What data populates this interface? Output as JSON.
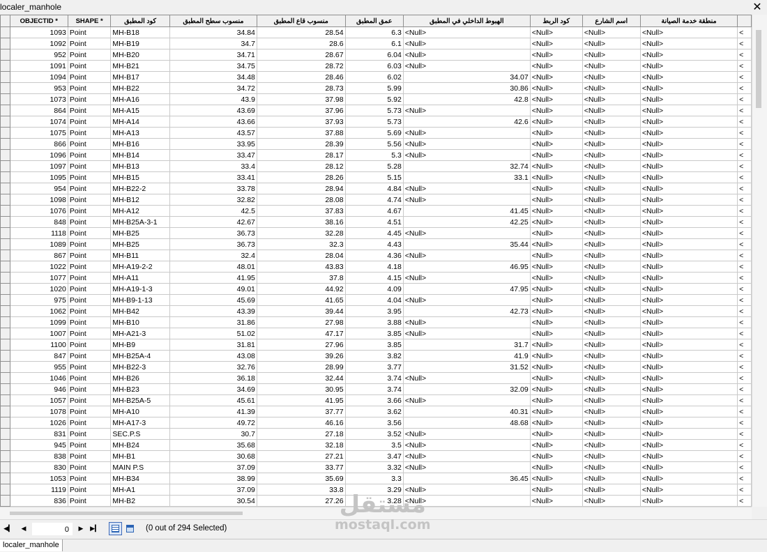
{
  "window": {
    "title": "localer_manhole",
    "close_glyph": "✕"
  },
  "table": {
    "columns": [
      "",
      "OBJECTID *",
      "SHAPE *",
      "كود المطبق",
      "منسوب سطح المطبق",
      "منسوب قاع المطبق",
      "عمق المطبق",
      "الهبوط الداخلي في المطبق",
      "كود الربط",
      "اسم الشارع",
      "منطقة خدمة الصيانة",
      ""
    ],
    "rows": [
      [
        "",
        "1093",
        "Point",
        "MH-B18",
        "34.84",
        "28.54",
        "6.3",
        "<Null>",
        "<Null>",
        "<Null>",
        "<Null>",
        "<"
      ],
      [
        "",
        "1092",
        "Point",
        "MH-B19",
        "34.7",
        "28.6",
        "6.1",
        "<Null>",
        "<Null>",
        "<Null>",
        "<Null>",
        "<"
      ],
      [
        "",
        "952",
        "Point",
        "MH-B20",
        "34.71",
        "28.67",
        "6.04",
        "<Null>",
        "<Null>",
        "<Null>",
        "<Null>",
        "<"
      ],
      [
        "",
        "1091",
        "Point",
        "MH-B21",
        "34.75",
        "28.72",
        "6.03",
        "<Null>",
        "<Null>",
        "<Null>",
        "<Null>",
        "<"
      ],
      [
        "",
        "1094",
        "Point",
        "MH-B17",
        "34.48",
        "28.46",
        "6.02",
        "34.07",
        "<Null>",
        "<Null>",
        "<Null>",
        "<"
      ],
      [
        "",
        "953",
        "Point",
        "MH-B22",
        "34.72",
        "28.73",
        "5.99",
        "30.86",
        "<Null>",
        "<Null>",
        "<Null>",
        "<"
      ],
      [
        "",
        "1073",
        "Point",
        "MH-A16",
        "43.9",
        "37.98",
        "5.92",
        "42.8",
        "<Null>",
        "<Null>",
        "<Null>",
        "<"
      ],
      [
        "",
        "864",
        "Point",
        "MH-A15",
        "43.69",
        "37.96",
        "5.73",
        "<Null>",
        "<Null>",
        "<Null>",
        "<Null>",
        "<"
      ],
      [
        "",
        "1074",
        "Point",
        "MH-A14",
        "43.66",
        "37.93",
        "5.73",
        "42.6",
        "<Null>",
        "<Null>",
        "<Null>",
        "<"
      ],
      [
        "",
        "1075",
        "Point",
        "MH-A13",
        "43.57",
        "37.88",
        "5.69",
        "<Null>",
        "<Null>",
        "<Null>",
        "<Null>",
        "<"
      ],
      [
        "",
        "866",
        "Point",
        "MH-B16",
        "33.95",
        "28.39",
        "5.56",
        "<Null>",
        "<Null>",
        "<Null>",
        "<Null>",
        "<"
      ],
      [
        "",
        "1096",
        "Point",
        "MH-B14",
        "33.47",
        "28.17",
        "5.3",
        "<Null>",
        "<Null>",
        "<Null>",
        "<Null>",
        "<"
      ],
      [
        "",
        "1097",
        "Point",
        "MH-B13",
        "33.4",
        "28.12",
        "5.28",
        "32.74",
        "<Null>",
        "<Null>",
        "<Null>",
        "<"
      ],
      [
        "",
        "1095",
        "Point",
        "MH-B15",
        "33.41",
        "28.26",
        "5.15",
        "33.1",
        "<Null>",
        "<Null>",
        "<Null>",
        "<"
      ],
      [
        "",
        "954",
        "Point",
        "MH-B22-2",
        "33.78",
        "28.94",
        "4.84",
        "<Null>",
        "<Null>",
        "<Null>",
        "<Null>",
        "<"
      ],
      [
        "",
        "1098",
        "Point",
        "MH-B12",
        "32.82",
        "28.08",
        "4.74",
        "<Null>",
        "<Null>",
        "<Null>",
        "<Null>",
        "<"
      ],
      [
        "",
        "1076",
        "Point",
        "MH-A12",
        "42.5",
        "37.83",
        "4.67",
        "41.45",
        "<Null>",
        "<Null>",
        "<Null>",
        "<"
      ],
      [
        "",
        "848",
        "Point",
        "MH-B25A-3-1",
        "42.67",
        "38.16",
        "4.51",
        "42.25",
        "<Null>",
        "<Null>",
        "<Null>",
        "<"
      ],
      [
        "",
        "1118",
        "Point",
        "MH-B25",
        "36.73",
        "32.28",
        "4.45",
        "<Null>",
        "<Null>",
        "<Null>",
        "<Null>",
        "<"
      ],
      [
        "",
        "1089",
        "Point",
        "MH-B25",
        "36.73",
        "32.3",
        "4.43",
        "35.44",
        "<Null>",
        "<Null>",
        "<Null>",
        "<"
      ],
      [
        "",
        "867",
        "Point",
        "MH-B11",
        "32.4",
        "28.04",
        "4.36",
        "<Null>",
        "<Null>",
        "<Null>",
        "<Null>",
        "<"
      ],
      [
        "",
        "1022",
        "Point",
        "MH-A19-2-2",
        "48.01",
        "43.83",
        "4.18",
        "46.95",
        "<Null>",
        "<Null>",
        "<Null>",
        "<"
      ],
      [
        "",
        "1077",
        "Point",
        "MH-A11",
        "41.95",
        "37.8",
        "4.15",
        "<Null>",
        "<Null>",
        "<Null>",
        "<Null>",
        "<"
      ],
      [
        "",
        "1020",
        "Point",
        "MH-A19-1-3",
        "49.01",
        "44.92",
        "4.09",
        "47.95",
        "<Null>",
        "<Null>",
        "<Null>",
        "<"
      ],
      [
        "",
        "975",
        "Point",
        "MH-B9-1-13",
        "45.69",
        "41.65",
        "4.04",
        "<Null>",
        "<Null>",
        "<Null>",
        "<Null>",
        "<"
      ],
      [
        "",
        "1062",
        "Point",
        "MH-B42",
        "43.39",
        "39.44",
        "3.95",
        "42.73",
        "<Null>",
        "<Null>",
        "<Null>",
        "<"
      ],
      [
        "",
        "1099",
        "Point",
        "MH-B10",
        "31.86",
        "27.98",
        "3.88",
        "<Null>",
        "<Null>",
        "<Null>",
        "<Null>",
        "<"
      ],
      [
        "",
        "1007",
        "Point",
        "MH-A21-3",
        "51.02",
        "47.17",
        "3.85",
        "<Null>",
        "<Null>",
        "<Null>",
        "<Null>",
        "<"
      ],
      [
        "",
        "1100",
        "Point",
        "MH-B9",
        "31.81",
        "27.96",
        "3.85",
        "31.7",
        "<Null>",
        "<Null>",
        "<Null>",
        "<"
      ],
      [
        "",
        "847",
        "Point",
        "MH-B25A-4",
        "43.08",
        "39.26",
        "3.82",
        "41.9",
        "<Null>",
        "<Null>",
        "<Null>",
        "<"
      ],
      [
        "",
        "955",
        "Point",
        "MH-B22-3",
        "32.76",
        "28.99",
        "3.77",
        "31.52",
        "<Null>",
        "<Null>",
        "<Null>",
        "<"
      ],
      [
        "",
        "1046",
        "Point",
        "MH-B26",
        "36.18",
        "32.44",
        "3.74",
        "<Null>",
        "<Null>",
        "<Null>",
        "<Null>",
        "<"
      ],
      [
        "",
        "946",
        "Point",
        "MH-B23",
        "34.69",
        "30.95",
        "3.74",
        "32.09",
        "<Null>",
        "<Null>",
        "<Null>",
        "<"
      ],
      [
        "",
        "1057",
        "Point",
        "MH-B25A-5",
        "45.61",
        "41.95",
        "3.66",
        "<Null>",
        "<Null>",
        "<Null>",
        "<Null>",
        "<"
      ],
      [
        "",
        "1078",
        "Point",
        "MH-A10",
        "41.39",
        "37.77",
        "3.62",
        "40.31",
        "<Null>",
        "<Null>",
        "<Null>",
        "<"
      ],
      [
        "",
        "1026",
        "Point",
        "MH-A17-3",
        "49.72",
        "46.16",
        "3.56",
        "48.68",
        "<Null>",
        "<Null>",
        "<Null>",
        "<"
      ],
      [
        "",
        "831",
        "Point",
        "SEC.P.S",
        "30.7",
        "27.18",
        "3.52",
        "<Null>",
        "<Null>",
        "<Null>",
        "<Null>",
        "<"
      ],
      [
        "",
        "945",
        "Point",
        "MH-B24",
        "35.68",
        "32.18",
        "3.5",
        "<Null>",
        "<Null>",
        "<Null>",
        "<Null>",
        "<"
      ],
      [
        "",
        "838",
        "Point",
        "MH-B1",
        "30.68",
        "27.21",
        "3.47",
        "<Null>",
        "<Null>",
        "<Null>",
        "<Null>",
        "<"
      ],
      [
        "",
        "830",
        "Point",
        "MAIN P.S",
        "37.09",
        "33.77",
        "3.32",
        "<Null>",
        "<Null>",
        "<Null>",
        "<Null>",
        "<"
      ],
      [
        "",
        "1053",
        "Point",
        "MH-B34",
        "38.99",
        "35.69",
        "3.3",
        "36.45",
        "<Null>",
        "<Null>",
        "<Null>",
        "<"
      ],
      [
        "",
        "1119",
        "Point",
        "MH-A1",
        "37.09",
        "33.8",
        "3.29",
        "<Null>",
        "<Null>",
        "<Null>",
        "<Null>",
        "<"
      ],
      [
        "",
        "836",
        "Point",
        "MH-B2",
        "30.54",
        "27.26",
        "3.28",
        "<Null>",
        "<Null>",
        "<Null>",
        "<Null>",
        "<"
      ]
    ]
  },
  "navigation": {
    "first_icon": "first-record-icon",
    "prev_icon": "previous-record-icon",
    "next_icon": "next-record-icon",
    "last_icon": "last-record-icon",
    "current_record": "0",
    "selection_status": "(0 out of 294 Selected)"
  },
  "tabs": [
    "localer_manhole"
  ],
  "watermark": {
    "arabic": "مستقل",
    "latin": "mostaql.com"
  }
}
